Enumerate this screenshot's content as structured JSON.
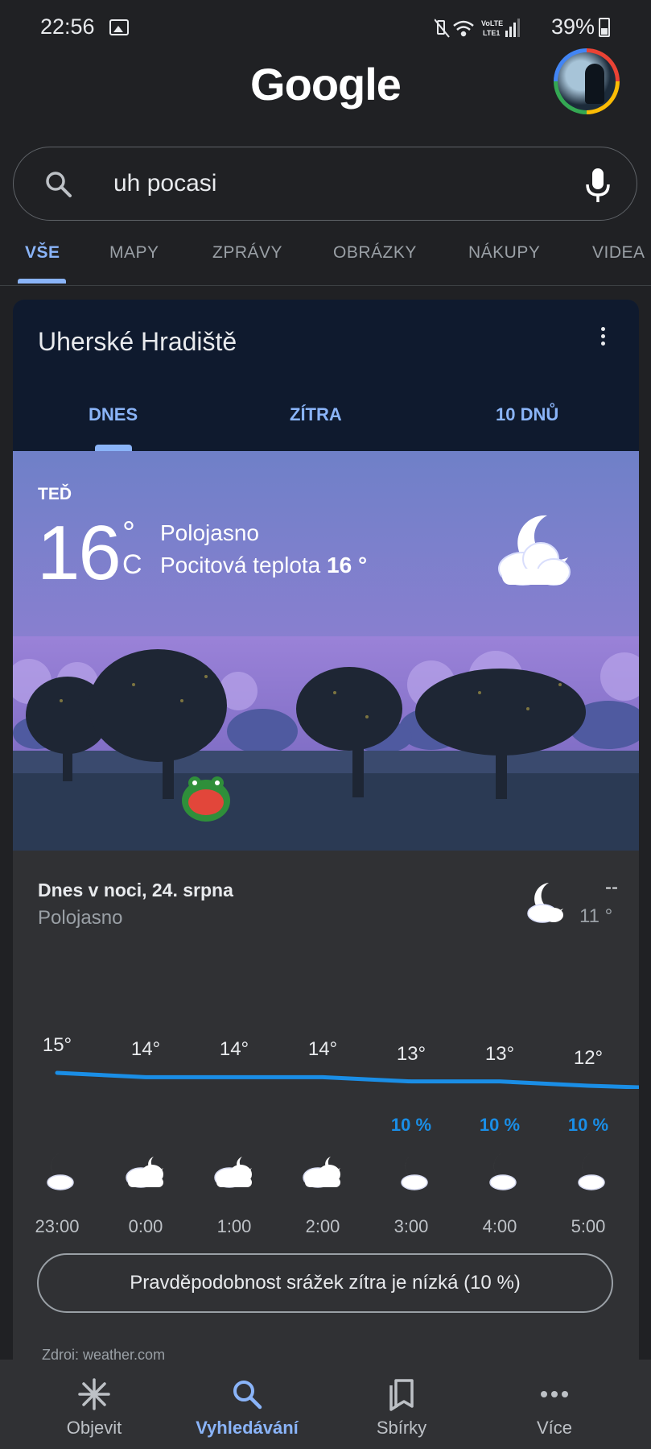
{
  "status_bar": {
    "time": "22:56",
    "battery": "39%",
    "icons": [
      "gallery-icon",
      "vibrate-mute-icon",
      "wifi-icon",
      "volte-lte-icon",
      "signal-icon",
      "battery-icon"
    ]
  },
  "header": {
    "logo": "Google",
    "avatar": "account-avatar"
  },
  "search": {
    "query": "uh pocasi",
    "icons": [
      "search-icon",
      "mic-icon"
    ]
  },
  "tabs": [
    {
      "label": "VŠE",
      "active": true
    },
    {
      "label": "MAPY"
    },
    {
      "label": "ZPRÁVY"
    },
    {
      "label": "OBRÁZKY"
    },
    {
      "label": "NÁKUPY"
    },
    {
      "label": "VIDEA"
    }
  ],
  "weather": {
    "location": "Uherské Hradiště",
    "tabs": [
      {
        "label": "DNES",
        "active": true
      },
      {
        "label": "ZÍTRA"
      },
      {
        "label": "10 DNŮ"
      }
    ],
    "now": {
      "label": "TEĎ",
      "temp": "16",
      "deg": "°",
      "unit": "C",
      "condition": "Polojasno",
      "feels_prefix": "Pocitová teplota",
      "feels_value": "16 °",
      "icon": "partly-cloudy-night-icon"
    },
    "tonight": {
      "title": "Dnes v noci, 24. srpna",
      "condition": "Polojasno",
      "hi": "--",
      "lo": "11 °",
      "icon": "partly-cloudy-night-icon"
    },
    "hourly": [
      {
        "time": "23:00",
        "temp": "15°",
        "precip": "",
        "icon": "moon-cloud-icon"
      },
      {
        "time": "0:00",
        "temp": "14°",
        "precip": "",
        "icon": "cloud-moon-icon"
      },
      {
        "time": "1:00",
        "temp": "14°",
        "precip": "",
        "icon": "cloud-moon-icon"
      },
      {
        "time": "2:00",
        "temp": "14°",
        "precip": "",
        "icon": "cloud-moon-icon"
      },
      {
        "time": "3:00",
        "temp": "13°",
        "precip": "10 %",
        "icon": "moon-cloud-icon"
      },
      {
        "time": "4:00",
        "temp": "13°",
        "precip": "10 %",
        "icon": "moon-cloud-icon"
      },
      {
        "time": "5:00",
        "temp": "12°",
        "precip": "10 %",
        "icon": "moon-cloud-icon"
      }
    ],
    "rain_summary": "Pravděpodobnost srážek zítra je nízká (10 %)",
    "source": "Zdroj: weather.com",
    "colors": {
      "accent": "#8ab4f8",
      "precip": "#1a8ee6",
      "hero_sky": "#7b82cc",
      "header_bg": "#0f1a2e"
    }
  },
  "bottom_nav": [
    {
      "label": "Objevit",
      "icon": "asterisk-icon"
    },
    {
      "label": "Vyhledávání",
      "icon": "search-icon",
      "active": true
    },
    {
      "label": "Sbírky",
      "icon": "collections-icon"
    },
    {
      "label": "Více",
      "icon": "more-horizontal-icon"
    }
  ]
}
